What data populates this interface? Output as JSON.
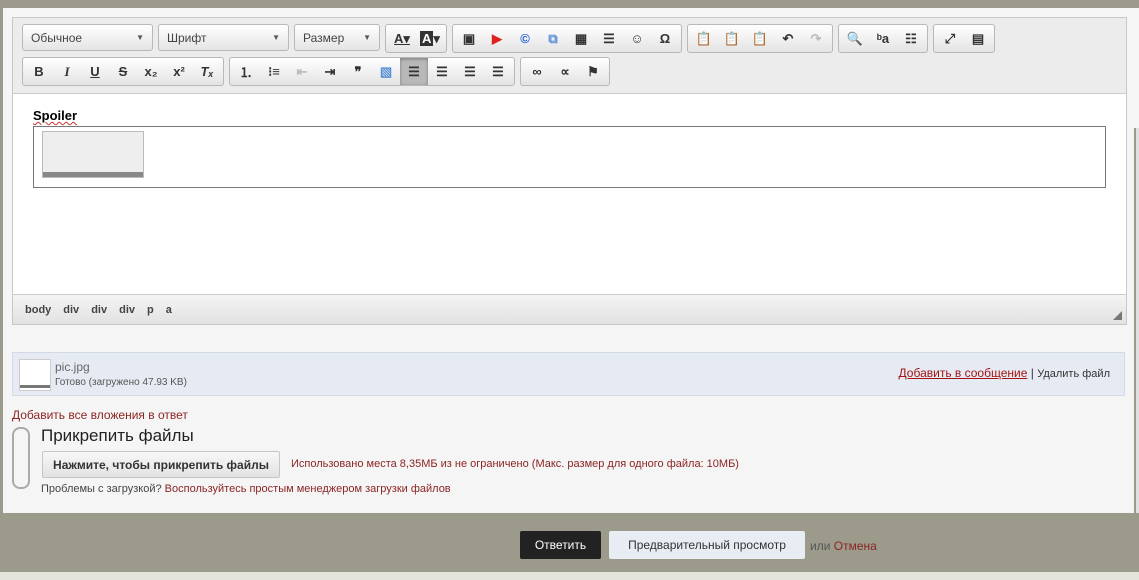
{
  "toolbar": {
    "format": "Обычное",
    "font": "Шрифт",
    "size": "Размер",
    "row1_groups": [
      [
        "text-color",
        "bg-color"
      ],
      [
        "image",
        "youtube",
        "copyright",
        "flash",
        "table",
        "horizontal-rule",
        "smiley",
        "special-char"
      ],
      [
        "paste",
        "paste-text",
        "paste-word",
        "undo",
        "redo"
      ],
      [
        "find",
        "replace",
        "select-all"
      ],
      [
        "maximize",
        "show-blocks"
      ]
    ],
    "row2_groups": [
      [
        "bold",
        "italic",
        "underline",
        "strike",
        "subscript",
        "superscript",
        "remove-format"
      ],
      [
        "numbered-list",
        "bulleted-list",
        "outdent",
        "indent",
        "blockquote",
        "template",
        "align-left",
        "align-center",
        "align-right",
        "justify"
      ],
      [
        "link",
        "unlink",
        "anchor"
      ]
    ],
    "active": "align-left"
  },
  "editor": {
    "spoiler_label": "Spoiler"
  },
  "path": [
    "body",
    "div",
    "div",
    "div",
    "p",
    "a"
  ],
  "attachment": {
    "filename": "pic.jpg",
    "status": "Готово (загружено 47.93 KB)",
    "insert_link": "Добавить в сообщение",
    "separator": "|",
    "delete_link": "Удалить файл"
  },
  "add_all": "Добавить все вложения в ответ",
  "attach": {
    "title": "Прикрепить файлы",
    "button": "Нажмите, чтобы прикрепить файлы",
    "usage": "Использовано места 8,35МБ из не ограничено (Макс. размер для одного файла: 10МБ)",
    "problem": "Проблемы с загрузкой?",
    "simple_link": "Воспользуйтесь простым менеджером загрузки файлов"
  },
  "actions": {
    "reply": "Ответить",
    "preview": "Предварительный просмотр",
    "or": "или",
    "cancel": "Отмена"
  }
}
